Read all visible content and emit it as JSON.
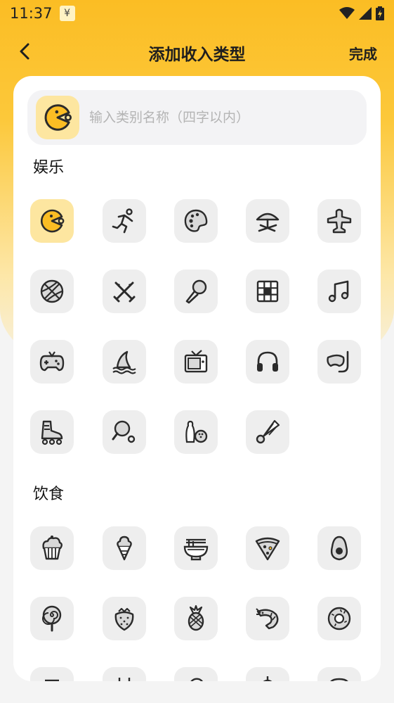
{
  "status_bar": {
    "time": "11:37",
    "notify_glyph": "¥"
  },
  "nav": {
    "title": "添加收入类型",
    "done_label": "完成"
  },
  "name_field": {
    "placeholder": "输入类别名称（四字以内）",
    "value": ""
  },
  "sections": [
    {
      "title": "娱乐",
      "icons": [
        "pacman-icon",
        "runner-icon",
        "palette-icon",
        "beach-umbrella-icon",
        "airplane-icon",
        "basketball-icon",
        "crossed-swords-icon",
        "microphone-icon",
        "rubiks-cube-icon",
        "music-note-icon",
        "gamepad-icon",
        "shark-fin-icon",
        "television-icon",
        "headphones-icon",
        "diving-mask-icon",
        "roller-skate-icon",
        "ping-pong-icon",
        "bowling-icon",
        "badminton-icon"
      ],
      "selected_index": 0
    },
    {
      "title": "饮食",
      "icons": [
        "cupcake-icon",
        "ice-cream-icon",
        "noodle-bowl-icon",
        "pizza-icon",
        "avocado-icon",
        "lollipop-icon",
        "strawberry-icon",
        "pineapple-icon",
        "shrimp-icon",
        "donut-icon",
        "partial-icon-1",
        "partial-icon-2",
        "partial-icon-3",
        "partial-icon-4",
        "partial-icon-5"
      ]
    }
  ],
  "colors": {
    "accent": "#fbbd24",
    "selected_bg": "#fde6a0",
    "icon_bg": "#eeeeee",
    "icon_stroke": "#2b2b2b"
  }
}
